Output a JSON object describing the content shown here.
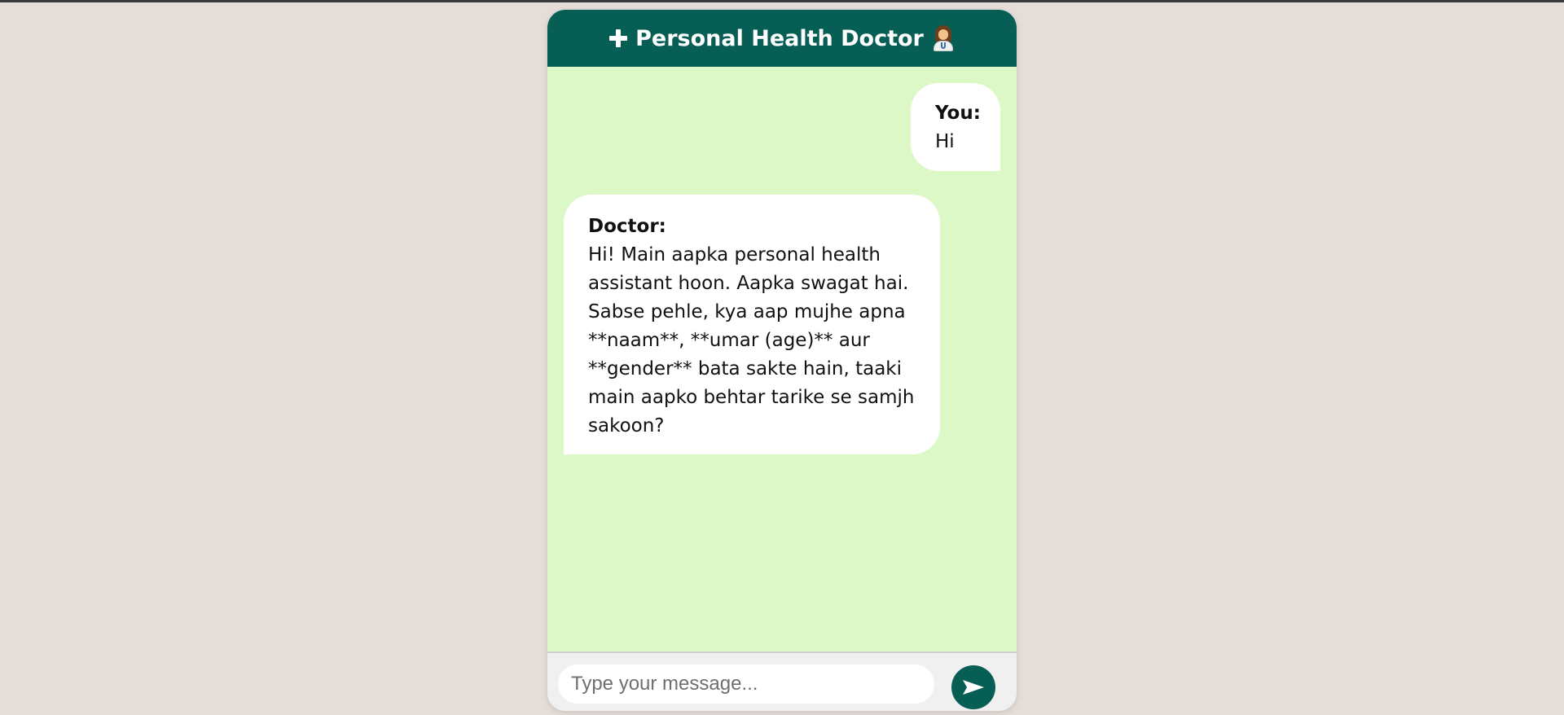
{
  "header": {
    "title": "Personal Health Doctor",
    "leading_icon": "medical-cross-icon",
    "trailing_icon": "woman-health-worker-icon"
  },
  "messages": [
    {
      "sender": "You:",
      "text": "Hi"
    },
    {
      "sender": "Doctor:",
      "text": "Hi! Main aapka personal health assistant hoon. Aapka swagat hai. Sabse pehle, kya aap mujhe apna **naam**, **umar (age)** aur **gender** bata sakte hain, taaki main aapko behtar tarike se samjh sakoon?"
    }
  ],
  "composer": {
    "placeholder": "Type your message...",
    "value": "",
    "send_icon": "send-arrow-icon"
  },
  "colors": {
    "page_background": "#e5ddd8",
    "header_background": "#075e54",
    "chat_background": "#dcf8c6",
    "bubble_background": "#ffffff",
    "send_button": "#075e54"
  }
}
